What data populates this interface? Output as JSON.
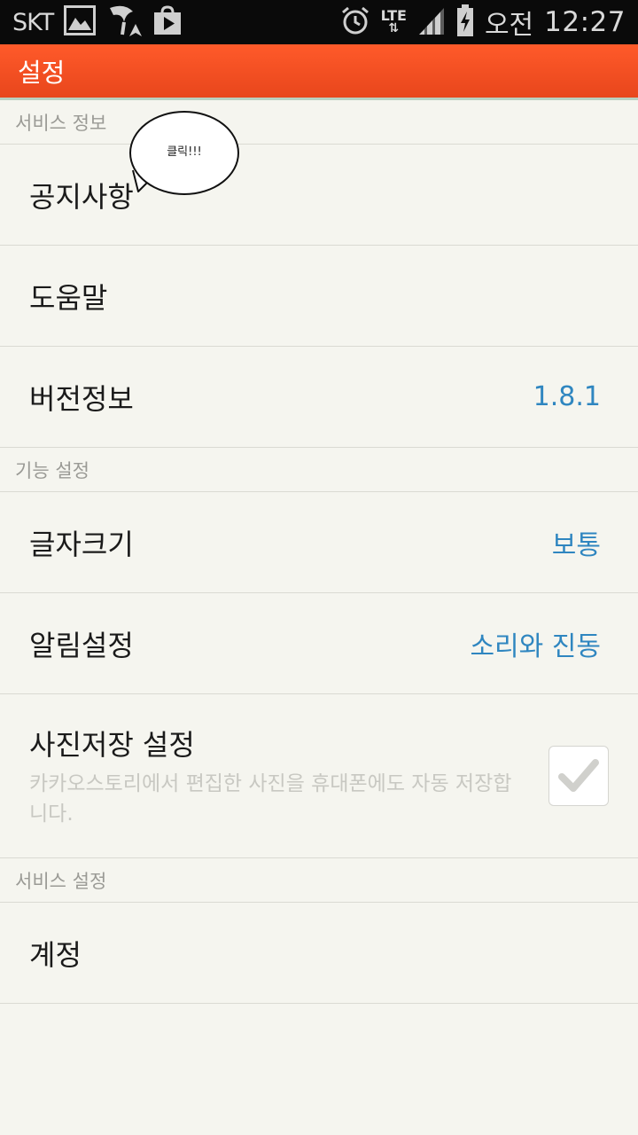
{
  "status_bar": {
    "carrier": "SKT",
    "network": "LTE",
    "ampm": "오전",
    "time": "12:27",
    "icons": [
      "gallery-icon",
      "tmap-icon",
      "play-store-icon",
      "alarm-icon",
      "lte-icon",
      "signal-icon",
      "battery-charging-icon"
    ]
  },
  "action_bar": {
    "title": "설정"
  },
  "annotation": {
    "text": "클릭!!!"
  },
  "sections": {
    "service_info": {
      "header": "서비스 정보",
      "notice": "공지사항",
      "help": "도움말",
      "version_label": "버전정보",
      "version_value": "1.8.1"
    },
    "feature_settings": {
      "header": "기능 설정",
      "font_size_label": "글자크기",
      "font_size_value": "보통",
      "notification_label": "알림설정",
      "notification_value": "소리와 진동",
      "photo_save_label": "사진저장 설정",
      "photo_save_desc": "카카오스토리에서 편집한 사진을 휴대폰에도 자동 저장합니다.",
      "photo_save_checked": true
    },
    "service_settings": {
      "header": "서비스 설정",
      "account": "계정"
    }
  },
  "colors": {
    "accent_orange": "#ff5a2a",
    "value_blue": "#2f86c0",
    "background": "#f5f5ef"
  }
}
